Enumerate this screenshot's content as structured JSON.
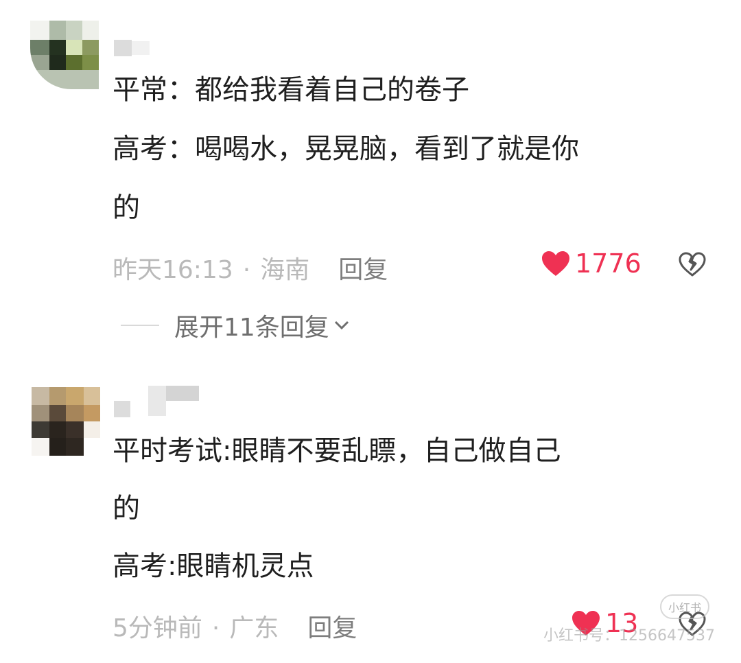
{
  "comments": [
    {
      "content_lines": [
        "平常：都给我看着自己的卷子",
        "高考：喝喝水，晃晃脑，看到了就是你",
        "的"
      ],
      "time": "昨天16:13",
      "separator": "·",
      "location": "海南",
      "reply_label": "回复",
      "likes": "1776",
      "expand_label": "展开11条回复"
    },
    {
      "content_lines": [
        "平时考试:眼睛不要乱瞟，自己做自己",
        "的",
        "高考:眼睛机灵点"
      ],
      "time": "5分钟前",
      "separator": "·",
      "location": "广东",
      "reply_label": "回复",
      "likes": "13"
    }
  ],
  "watermark": {
    "logo_text": "小红书",
    "text": "小红书号：1256647537"
  },
  "colors": {
    "like_red": "#ef3153",
    "meta_gray": "#b9b9b9",
    "reply_gray": "#7e7e7e",
    "text": "#1f1f1f"
  },
  "icons": {
    "like": "heart-icon",
    "dislike": "broken-heart-icon",
    "expand": "chevron-down-icon"
  }
}
